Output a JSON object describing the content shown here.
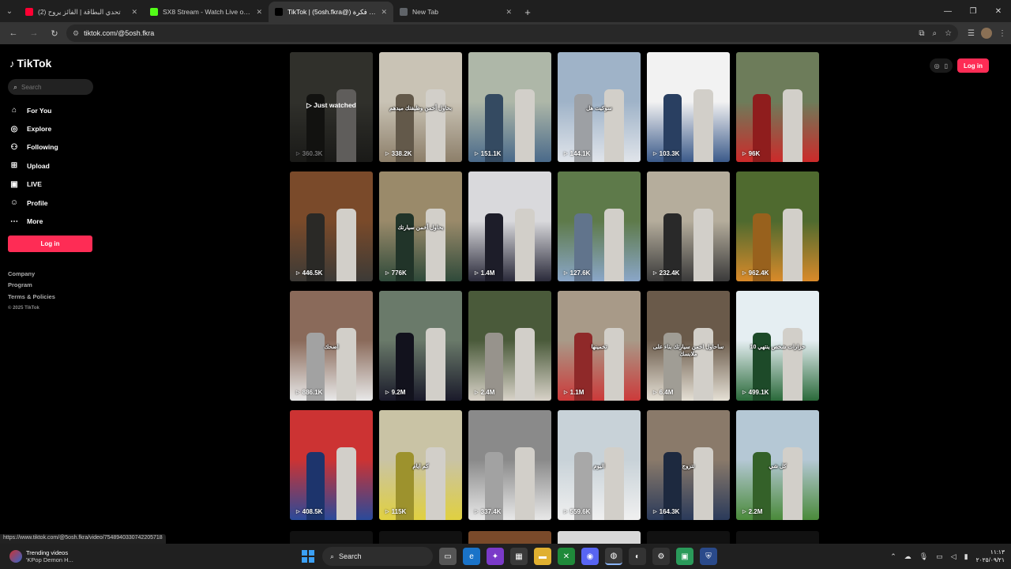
{
  "browser": {
    "tabs": [
      {
        "title": "(2) تحدي البطاقة | الفائز يروح",
        "fav_color": "#ff0033",
        "active": false
      },
      {
        "title": "SX8 Stream - Watch Live on Kick",
        "fav_color": "#53fc18",
        "active": false
      },
      {
        "title": "TikTok | (5osh.fkra@) خوش فكرة",
        "fav_color": "#000000",
        "active": true
      },
      {
        "title": "New Tab",
        "fav_color": "#5f6368",
        "active": false
      }
    ],
    "url": "tiktok.com/@5osh.fkra",
    "status_url": "https://www.tiktok.com/@5osh.fkra/video/7548940330742205718"
  },
  "sidebar": {
    "logo": "TikTok",
    "search_placeholder": "Search",
    "nav": [
      {
        "label": "For You",
        "icon": "home-icon"
      },
      {
        "label": "Explore",
        "icon": "compass-icon"
      },
      {
        "label": "Following",
        "icon": "users-icon"
      },
      {
        "label": "Upload",
        "icon": "plus-square-icon"
      },
      {
        "label": "LIVE",
        "icon": "live-icon"
      },
      {
        "label": "Profile",
        "icon": "person-icon"
      },
      {
        "label": "More",
        "icon": "dots-icon"
      }
    ],
    "login": "Log in",
    "footer": [
      "Company",
      "Program",
      "Terms & Policies"
    ],
    "copyright": "© 2025 TikTok"
  },
  "header": {
    "login": "Log in"
  },
  "videos": [
    {
      "views": "360.3K",
      "caption": "",
      "watched": "Just watched",
      "colors": [
        "#6b6b60",
        "#3a3a35"
      ]
    },
    {
      "views": "338.2K",
      "caption": "بحاول أخمن وظيفتك ميدهم",
      "watched": "",
      "colors": [
        "#c9c3b5",
        "#8d7f6a"
      ]
    },
    {
      "views": "151.1K",
      "caption": "",
      "watched": "",
      "colors": [
        "#aeb7a8",
        "#4a6a8a"
      ]
    },
    {
      "views": "144.1K",
      "caption": "سوكيت هل",
      "watched": "",
      "colors": [
        "#9fb3c8",
        "#e0e4ea"
      ]
    },
    {
      "views": "103.3K",
      "caption": "",
      "watched": "",
      "colors": [
        "#f2f2f2",
        "#3b5a8a"
      ]
    },
    {
      "views": "96K",
      "caption": "",
      "watched": "",
      "colors": [
        "#6d7c5a",
        "#cc2a2a"
      ]
    },
    {
      "views": "446.5K",
      "caption": "",
      "watched": "",
      "colors": [
        "#7a4a2a",
        "#3c3a36"
      ]
    },
    {
      "views": "776K",
      "caption": "بحاول أخمن سيارتك",
      "watched": "",
      "colors": [
        "#9a8a6a",
        "#2f4a3a"
      ]
    },
    {
      "views": "1.4M",
      "caption": "",
      "watched": "",
      "colors": [
        "#d9d9dc",
        "#2a2a3a"
      ]
    },
    {
      "views": "127.6K",
      "caption": "",
      "watched": "",
      "colors": [
        "#5e7a4a",
        "#8aa6c8"
      ]
    },
    {
      "views": "232.4K",
      "caption": "",
      "watched": "",
      "colors": [
        "#b5ad9c",
        "#3a3a3a"
      ]
    },
    {
      "views": "962.4K",
      "caption": "",
      "watched": "",
      "colors": [
        "#4f6a2f",
        "#d98a2a"
      ]
    },
    {
      "views": "886.1K",
      "caption": "اضحك",
      "watched": "",
      "colors": [
        "#8a6a5a",
        "#e8e8e8"
      ]
    },
    {
      "views": "9.2M",
      "caption": "",
      "watched": "",
      "colors": [
        "#6a7a6a",
        "#1a1a2a"
      ]
    },
    {
      "views": "2.4M",
      "caption": "",
      "watched": "",
      "colors": [
        "#4a5a3a",
        "#d8d2c8"
      ]
    },
    {
      "views": "1.1M",
      "caption": "تخمينها",
      "watched": "",
      "colors": [
        "#a89a88",
        "#cc3a3a"
      ]
    },
    {
      "views": "6.4M",
      "caption": "ساحاول اخمن سيارتك بناء على ملابسك",
      "watched": "",
      "colors": [
        "#6a5a4a",
        "#e5e0d5"
      ]
    },
    {
      "views": "499.1K",
      "caption": "10 حزارات شخص ينتهي",
      "watched": "",
      "colors": [
        "#e5eef2",
        "#2a6a3a"
      ]
    },
    {
      "views": "408.5K",
      "caption": "",
      "watched": "",
      "colors": [
        "#cc3333",
        "#2a4a9a"
      ]
    },
    {
      "views": "115K",
      "caption": "كم ايام",
      "watched": "",
      "colors": [
        "#c9c3a5",
        "#e0d040"
      ]
    },
    {
      "views": "337.4K",
      "caption": "",
      "watched": "",
      "colors": [
        "#8a8a8a",
        "#e8e8e8"
      ]
    },
    {
      "views": "559.6K",
      "caption": "اليوم",
      "watched": "",
      "colors": [
        "#c8d2d8",
        "#f0f0f0"
      ]
    },
    {
      "views": "164.3K",
      "caption": "تتزوج",
      "watched": "",
      "colors": [
        "#8a7a6a",
        "#2a3a5a"
      ]
    },
    {
      "views": "2.2M",
      "caption": "كل شي",
      "watched": "",
      "colors": [
        "#b5c8d5",
        "#4a8a3a"
      ]
    }
  ],
  "taskbar": {
    "widget_title": "Trending videos",
    "widget_sub": "'KPop Demon H...",
    "search": "Search",
    "time": "١١:١٣",
    "date": "٢٠٢٥/٠٩/٢١"
  }
}
